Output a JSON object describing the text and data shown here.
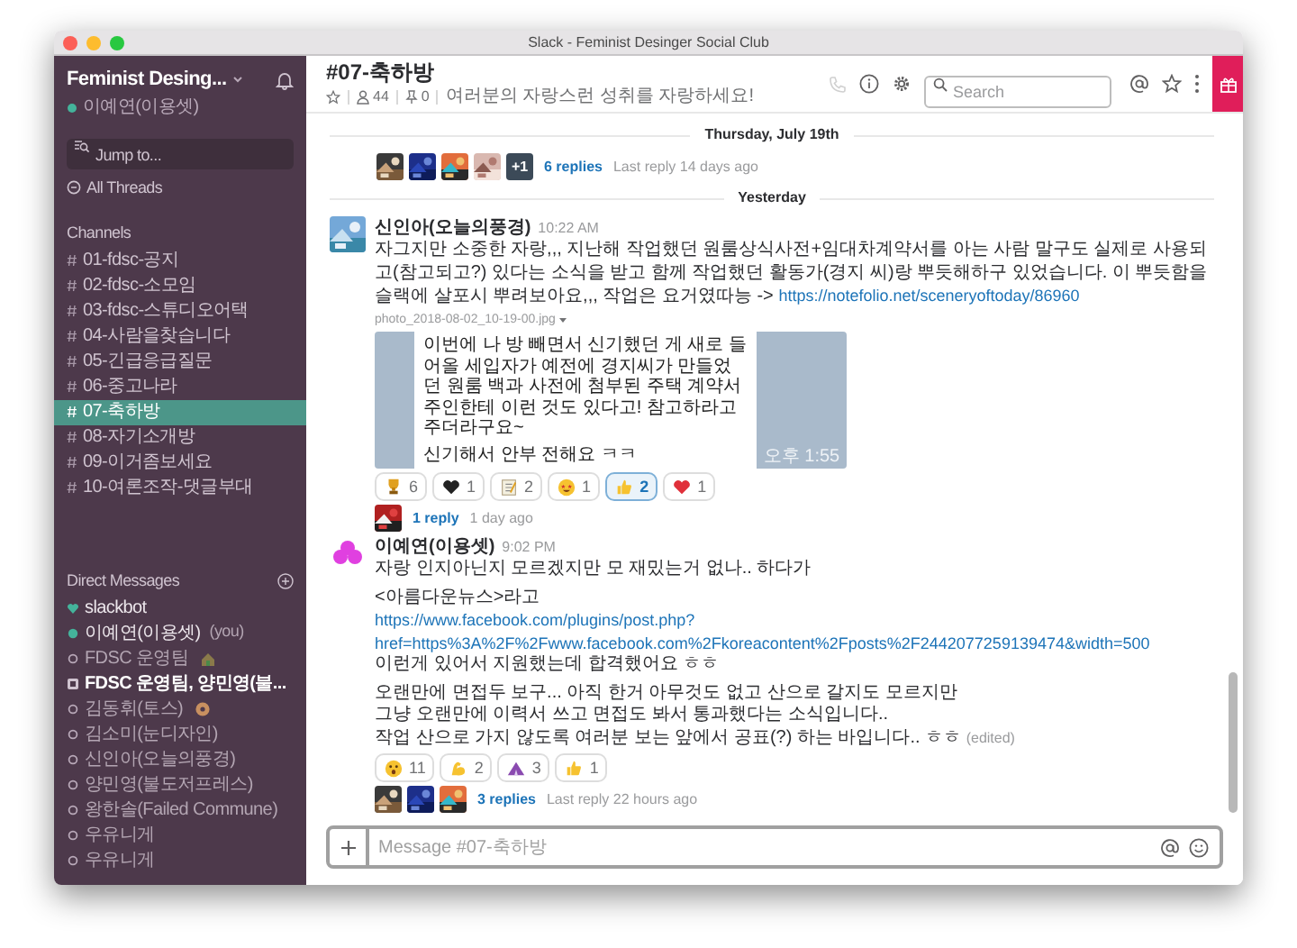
{
  "window": {
    "title": "Slack - Feminist Desinger Social Club"
  },
  "sidebar": {
    "workspace": "Feminist Desing...",
    "user": {
      "name": "이예연(이용셋)",
      "online": true
    },
    "jump_to": {
      "placeholder": "Jump to..."
    },
    "all_threads": "All Threads",
    "channels_label": "Channels",
    "channels": [
      {
        "name": "01-fdsc-공지",
        "selected": false
      },
      {
        "name": "02-fdsc-소모임",
        "selected": false
      },
      {
        "name": "03-fdsc-스튜디오어택",
        "selected": false
      },
      {
        "name": "04-사람을찾습니다",
        "selected": false
      },
      {
        "name": "05-긴급응급질문",
        "selected": false
      },
      {
        "name": "06-중고나라",
        "selected": false
      },
      {
        "name": "07-축하방",
        "selected": true
      },
      {
        "name": "08-자기소개방",
        "selected": false
      },
      {
        "name": "09-이거좀보세요",
        "selected": false
      },
      {
        "name": "10-여론조작-댓글부대",
        "selected": false
      }
    ],
    "dm_label": "Direct Messages",
    "direct_messages": [
      {
        "name": "slackbot",
        "kind": "bot",
        "unread": false
      },
      {
        "name": "이예연(이용셋)",
        "kind": "online",
        "you": "(you)",
        "unread": false
      },
      {
        "name": "FDSC 운영팀",
        "kind": "offline",
        "status": {
          "kind": "house"
        },
        "unread": false
      },
      {
        "name": "FDSC 운영팀, 양민영(불...",
        "kind": "group",
        "unread": true
      },
      {
        "name": "김동휘(토스)",
        "kind": "offline",
        "status": {
          "kind": "donut"
        },
        "unread": false
      },
      {
        "name": "김소미(눈디자인)",
        "kind": "offline",
        "unread": false
      },
      {
        "name": "신인아(오늘의풍경)",
        "kind": "offline",
        "unread": false
      },
      {
        "name": "양민영(불도저프레스)",
        "kind": "offline",
        "unread": false
      },
      {
        "name": "왕한솔(Failed Commune)",
        "kind": "offline",
        "unread": false
      },
      {
        "name": "우유니게",
        "kind": "offline",
        "unread": false
      },
      {
        "name": "우유니게",
        "kind": "offline",
        "unread": false
      }
    ]
  },
  "channel_header": {
    "title": "#07-축하방",
    "members": "44",
    "pins": "0",
    "topic": "여러분의 자랑스런 성취를 자랑하세요!",
    "search": {
      "placeholder": "Search"
    }
  },
  "messages": [
    {
      "kind": "divider",
      "label": "Thursday, July 19th"
    },
    {
      "kind": "thread",
      "avatars": [
        {
          "kind": "picture"
        },
        {
          "kind": "picture"
        },
        {
          "kind": "picture"
        },
        {
          "kind": "picture"
        }
      ],
      "more": "+1",
      "replies": "6 replies",
      "meta": "Last reply 14 days ago"
    },
    {
      "kind": "divider",
      "label": "Yesterday"
    },
    {
      "kind": "message",
      "avatar": {
        "kind": "picture"
      },
      "author": "신인아(오늘의풍경)",
      "time": "10:22 AM",
      "paragraphs": [
        [
          {
            "text": "자그지만 소중한 자랑,,, 지난해 작업했던 원룸상식사전+임대차계약서를 아는 사람 말구도 실제로 사용되고(참고되고?) 있다는 소식을 받고 함께 작업했던 활동가(경지 씨)랑 뿌듯해하구 있었습니다. 이 뿌듯함을 슬랙에 살포시 뿌려보아요,,, 작업은 요거였따능 ->",
            "link": "https://notefolio.net/sceneryoftoday/86960"
          }
        ]
      ],
      "file": {
        "name": "photo_2018-08-02_10-19-00.jpg",
        "lines": [
          "이번에 나 방 빼면서 신기했던 게 새로 들어올 세입자가 예전에 경지씨가 만들었던 원룸 백과 사전에 첨부된 주택 계약서 주인한테 이런 것도 있다고! 참고하라고 주더라구요~",
          "신기해서 안부 전해요 ㅋㅋ"
        ],
        "time": "오후 1:55"
      },
      "reactions": [
        {
          "kind": "trophy",
          "count": "6",
          "selected": false
        },
        {
          "kind": "black_heart",
          "count": "1",
          "selected": false
        },
        {
          "kind": "memo",
          "count": "2",
          "selected": false
        },
        {
          "kind": "star_eyes",
          "count": "1",
          "selected": false
        },
        {
          "kind": "thumbs_up",
          "count": "2",
          "selected": true
        },
        {
          "kind": "red_heart",
          "count": "1",
          "selected": false
        }
      ],
      "thread": {
        "avatars": [
          {
            "kind": "picture"
          }
        ],
        "replies": "1 reply",
        "meta": "1 day ago"
      }
    },
    {
      "kind": "message",
      "avatar": {
        "kind": "flower"
      },
      "author": "이예연(이용셋)",
      "time": "9:02 PM",
      "paragraphs": [
        [
          {
            "text": "자랑 인지아닌지 모르겠지만 모 재밌는거 없나.. 하다가"
          }
        ],
        [
          {
            "text": "<아름다운뉴스>라고"
          },
          {
            "link_lines": [
              "https://www.facebook.com/plugins/post.php?",
              "href=https%3A%2F%2Fwww.facebook.com%2Fkoreacontent%2Fposts%2F2442077259139474&width=500"
            ]
          },
          {
            "text": "이런게 있어서 지원했는데 합격했어요 ㅎㅎ"
          }
        ],
        [
          {
            "text": "오랜만에 면접두 보구... 아직 한거 아무것도 없고 산으로 갈지도 모르지만"
          },
          {
            "text": "그냥 오랜만에 이력서 쓰고 면접도 봐서 통과했다는 소식입니다.."
          },
          {
            "text": "작업 산으로 가지 않도록 여러분 보는 앞에서 공표(?) 하는 바입니다.. ㅎㅎ",
            "edited": "(edited)"
          }
        ]
      ],
      "reactions": [
        {
          "kind": "astonished",
          "count": "11",
          "selected": false
        },
        {
          "kind": "muscle",
          "count": "2",
          "selected": false
        },
        {
          "kind": "tent",
          "count": "3",
          "selected": false
        },
        {
          "kind": "thumbs_up",
          "count": "1",
          "selected": false
        }
      ],
      "thread": {
        "avatars": [
          {
            "kind": "picture"
          },
          {
            "kind": "picture"
          },
          {
            "kind": "picture"
          }
        ],
        "replies": "3 replies",
        "meta": "Last reply 22 hours ago"
      }
    }
  ],
  "composer": {
    "placeholder": "Message #07-축하방"
  }
}
